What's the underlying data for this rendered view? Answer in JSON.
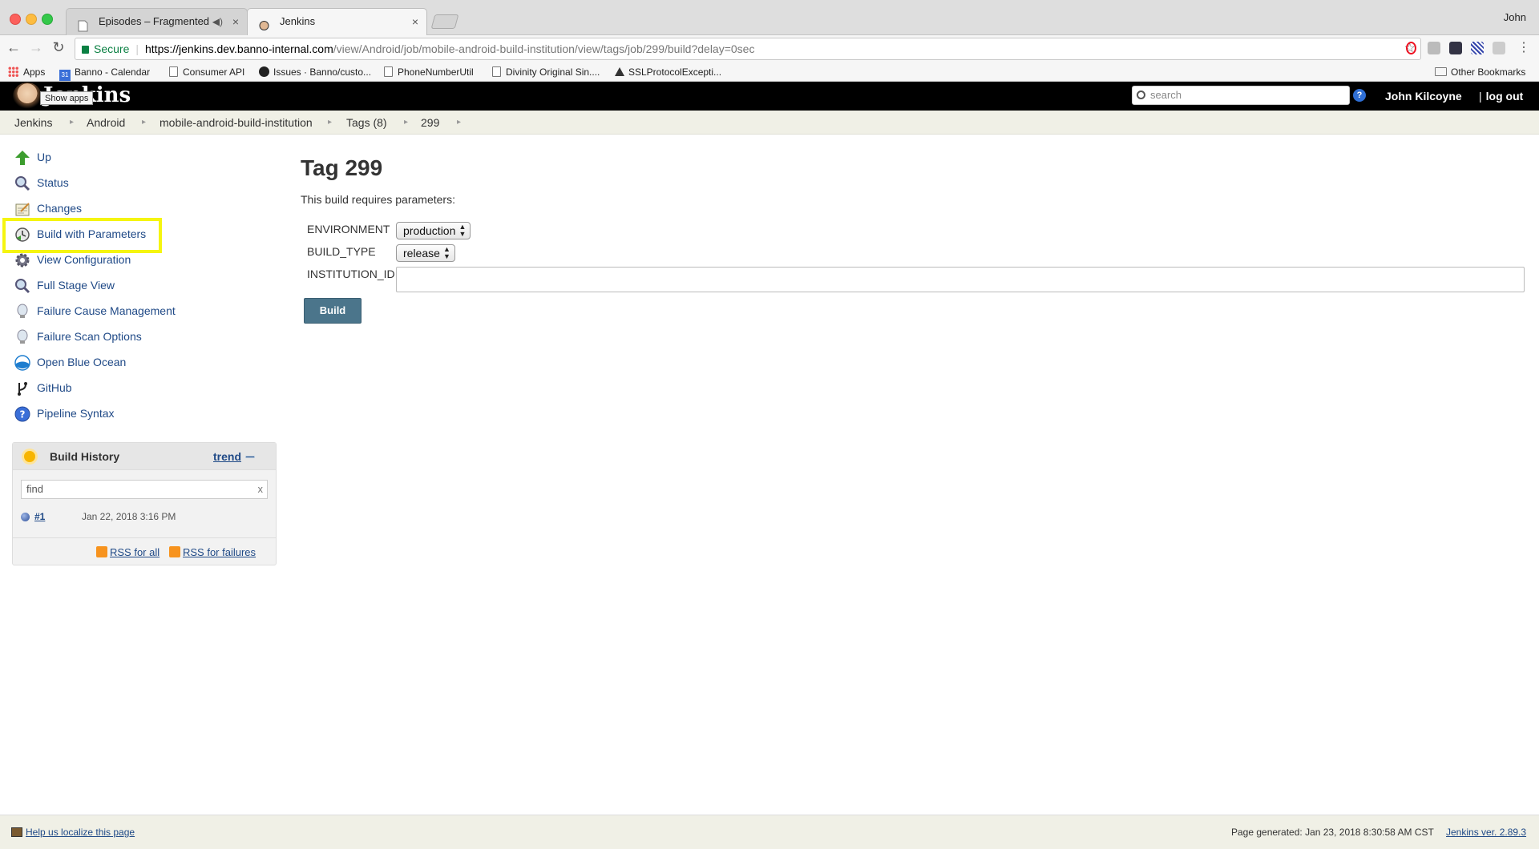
{
  "browser": {
    "profile_name": "John",
    "tabs": [
      {
        "title": "Episodes – Fragmented",
        "active": false
      },
      {
        "title": "Jenkins",
        "active": true
      }
    ],
    "address": {
      "secure_label": "Secure",
      "url_host": "https://jenkins.dev.banno-internal.com",
      "url_path": "/view/Android/job/mobile-android-build-institution/view/tags/job/299/build?delay=0sec"
    },
    "bookmarks": [
      {
        "label": "Apps",
        "icon": "apps-grid-icon"
      },
      {
        "label": "Banno - Calendar",
        "icon": "calendar-icon"
      },
      {
        "label": "Consumer API",
        "icon": "page-icon"
      },
      {
        "label": "Issues · Banno/custo...",
        "icon": "github-icon"
      },
      {
        "label": "PhoneNumberUtil",
        "icon": "page-icon"
      },
      {
        "label": "Divinity Original Sin....",
        "icon": "page-icon"
      },
      {
        "label": "SSLProtocolExcepti...",
        "icon": "triangle-logo-icon"
      }
    ],
    "other_bookmarks": "Other Bookmarks"
  },
  "jenkins": {
    "title": "Jenkins",
    "tooltip": "Show apps",
    "search_placeholder": "search",
    "help": "?",
    "user": "John Kilcoyne",
    "logout": "log out"
  },
  "breadcrumbs": [
    "Jenkins",
    "Android",
    "mobile-android-build-institution",
    "Tags (8)",
    "299"
  ],
  "sidebar": {
    "tasks": [
      {
        "label": "Up",
        "icon": "up-arrow-icon"
      },
      {
        "label": "Status",
        "icon": "magnifier-icon"
      },
      {
        "label": "Changes",
        "icon": "notepad-icon"
      },
      {
        "label": "Build with Parameters",
        "icon": "clock-build-icon"
      },
      {
        "label": "View Configuration",
        "icon": "gear-icon"
      },
      {
        "label": "Full Stage View",
        "icon": "magnifier-icon"
      },
      {
        "label": "Failure Cause Management",
        "icon": "lightbulb-icon"
      },
      {
        "label": "Failure Scan Options",
        "icon": "lightbulb-icon"
      },
      {
        "label": "Open Blue Ocean",
        "icon": "blue-ocean-icon"
      },
      {
        "label": "GitHub",
        "icon": "git-branch-icon"
      },
      {
        "label": "Pipeline Syntax",
        "icon": "help-circle-icon"
      }
    ],
    "highlighted_task": "Build with Parameters",
    "highlight_color": "#f5f510"
  },
  "build_history": {
    "title": "Build History",
    "trend_label": "trend",
    "find_placeholder": "find",
    "find_clear": "x",
    "builds": [
      {
        "number": "#1",
        "date": "Jan 22, 2018 3:16 PM"
      }
    ],
    "rss_all": "RSS for all",
    "rss_failures": "RSS for failures"
  },
  "main": {
    "title": "Tag 299",
    "requires_params": "This build requires parameters:",
    "params": [
      {
        "name": "ENVIRONMENT",
        "value": "production"
      },
      {
        "name": "BUILD_TYPE",
        "value": "release"
      },
      {
        "name": "INSTITUTION_ID",
        "value": ""
      }
    ],
    "build_button": "Build"
  },
  "footer": {
    "localize": "Help us localize this page",
    "generated": "Page generated: Jan 23, 2018 8:30:58 AM CST",
    "version": "Jenkins ver. 2.89.3"
  },
  "colors": {
    "header_bg": "#000000",
    "link": "#204a87",
    "build_button": "#4b758b",
    "breadcrumb_bg": "#f0f0e6"
  }
}
